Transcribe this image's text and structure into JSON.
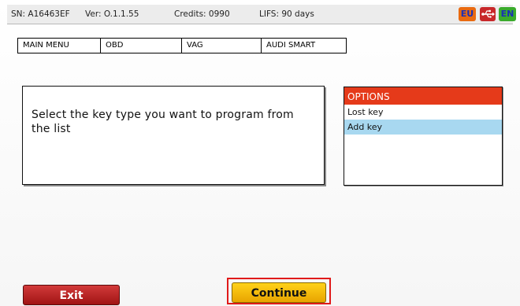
{
  "statusbar": {
    "serial": "SN: A16463EF",
    "version": "Ver: O.1.1.55",
    "credits": "Credits: 0990",
    "lifs": "LIFS: 90 days",
    "region_badge": "EU",
    "language_badge": "EN",
    "usb_icon": "usb-icon"
  },
  "breadcrumb": [
    "MAIN MENU",
    "OBD",
    "VAG",
    "AUDI SMART"
  ],
  "message": "Select the key type you want to program from the list",
  "options": {
    "header": "OPTIONS",
    "items": [
      "Lost key",
      "Add key"
    ],
    "selected_index": 1
  },
  "buttons": {
    "exit": "Exit",
    "continue": "Continue"
  },
  "colors": {
    "options_header": "#e53a1a",
    "selected_option": "#a8d8f0",
    "exit_button": "#b82020",
    "continue_button": "#f5be0a",
    "highlight_frame": "#e01a1a"
  }
}
